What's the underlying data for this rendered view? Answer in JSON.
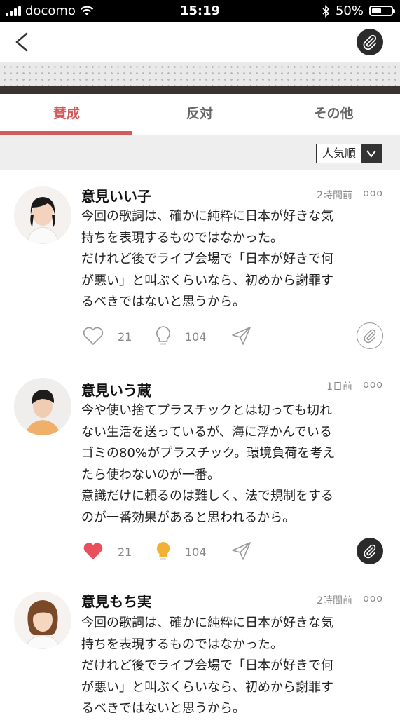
{
  "status": {
    "carrier": "docomo",
    "time": "15:19",
    "battery": "50%",
    "battery_level": 0.5
  },
  "nav": {
    "back_icon": "chevron-left-icon",
    "clip_icon": "paperclip-icon"
  },
  "tabs": [
    {
      "label": "賛成",
      "active": true
    },
    {
      "label": "反対",
      "active": false
    },
    {
      "label": "その他",
      "active": false
    }
  ],
  "sort": {
    "selected": "人気順"
  },
  "colors": {
    "accent": "#d25a5a",
    "like_active": "#e8505b",
    "bulb_active": "#f2b134",
    "dark": "#2b2b2b"
  },
  "posts": [
    {
      "author": "意見いい子",
      "time": "2時間前",
      "more": "ooo",
      "lines": [
        "今回の歌詞は、確かに純粋に日本が好きな気",
        "持ちを表現するものではなかった。",
        "だけれど後でライブ会場で「日本が好きで何",
        "が悪い」と叫ぶくらいなら、初めから謝罪す",
        "るべきではないと思うから。"
      ],
      "likes": "21",
      "ideas": "104",
      "liked": false
    },
    {
      "author": "意見いう蔵",
      "time": "1日前",
      "more": "ooo",
      "lines": [
        "今や使い捨てプラスチックとは切っても切れ",
        "ない生活を送っているが、海に浮かんでいる",
        "ゴミの80%がプラスチック。環境負荷を考え",
        "たら使わないのが一番。",
        "意識だけに頼るのは難しく、法で規制をする",
        "のが一番効果があると思われるから。"
      ],
      "likes": "21",
      "ideas": "104",
      "liked": true
    },
    {
      "author": "意見もち実",
      "time": "2時間前",
      "more": "ooo",
      "lines": [
        "今回の歌詞は、確かに純粋に日本が好きな気",
        "持ちを表現するものではなかった。",
        "だけれど後でライブ会場で「日本が好きで何",
        "が悪い」と叫ぶくらいなら、初めから謝罪す",
        "るべきではないと思うから。"
      ]
    }
  ]
}
